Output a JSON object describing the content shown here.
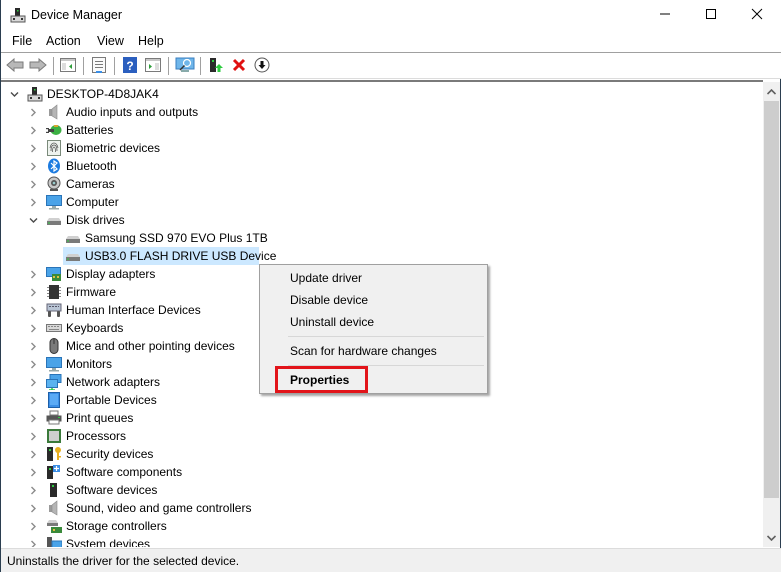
{
  "window": {
    "title": "Device Manager",
    "controls": {
      "minimize": "minimize",
      "maximize": "maximize",
      "close": "close"
    }
  },
  "menubar": {
    "items": [
      {
        "label": "File"
      },
      {
        "label": "Action"
      },
      {
        "label": "View"
      },
      {
        "label": "Help"
      }
    ]
  },
  "toolbar": {
    "buttons": [
      {
        "name": "back",
        "icon": "arrow-left-icon"
      },
      {
        "name": "forward",
        "icon": "arrow-right-icon"
      },
      {
        "name": "show-hide-console-tree",
        "icon": "console-tree-icon"
      },
      {
        "name": "properties",
        "icon": "properties-icon"
      },
      {
        "name": "help",
        "icon": "help-icon"
      },
      {
        "name": "show-hide-action-pane",
        "icon": "action-pane-icon"
      },
      {
        "name": "scan-hardware",
        "icon": "scan-monitor-icon"
      },
      {
        "name": "update-driver",
        "icon": "update-driver-icon"
      },
      {
        "name": "uninstall-device",
        "icon": "red-x-icon"
      },
      {
        "name": "disable-device",
        "icon": "down-arrow-circle-icon"
      }
    ]
  },
  "tree": {
    "root": {
      "label": "DESKTOP-4D8JAK4",
      "expanded": true
    },
    "categories": [
      {
        "label": "Audio inputs and outputs",
        "icon": "speaker-icon",
        "expanded": false
      },
      {
        "label": "Batteries",
        "icon": "battery-icon",
        "expanded": false
      },
      {
        "label": "Biometric devices",
        "icon": "fingerprint-icon",
        "expanded": false
      },
      {
        "label": "Bluetooth",
        "icon": "bluetooth-icon",
        "expanded": false
      },
      {
        "label": "Cameras",
        "icon": "webcam-icon",
        "expanded": false
      },
      {
        "label": "Computer",
        "icon": "monitor-icon",
        "expanded": false
      },
      {
        "label": "Disk drives",
        "icon": "disk-drive-icon",
        "expanded": true,
        "children": [
          {
            "label": "Samsung SSD 970 EVO Plus 1TB",
            "icon": "disk-drive-icon",
            "selected": false
          },
          {
            "label": "USB3.0 FLASH DRIVE USB Device",
            "icon": "disk-drive-icon",
            "selected": true
          }
        ]
      },
      {
        "label": "Display adapters",
        "icon": "display-adapter-icon",
        "expanded": false
      },
      {
        "label": "Firmware",
        "icon": "chip-icon",
        "expanded": false
      },
      {
        "label": "Human Interface Devices",
        "icon": "hid-icon",
        "expanded": false
      },
      {
        "label": "Keyboards",
        "icon": "keyboard-icon",
        "expanded": false
      },
      {
        "label": "Mice and other pointing devices",
        "icon": "mouse-icon",
        "expanded": false
      },
      {
        "label": "Monitors",
        "icon": "monitor-icon",
        "expanded": false
      },
      {
        "label": "Network adapters",
        "icon": "network-icon",
        "expanded": false
      },
      {
        "label": "Portable Devices",
        "icon": "portable-device-icon",
        "expanded": false
      },
      {
        "label": "Print queues",
        "icon": "printer-icon",
        "expanded": false
      },
      {
        "label": "Processors",
        "icon": "processor-icon",
        "expanded": false
      },
      {
        "label": "Security devices",
        "icon": "security-key-icon",
        "expanded": false
      },
      {
        "label": "Software components",
        "icon": "software-component-icon",
        "expanded": false
      },
      {
        "label": "Software devices",
        "icon": "software-device-icon",
        "expanded": false
      },
      {
        "label": "Sound, video and game controllers",
        "icon": "speaker-icon",
        "expanded": false
      },
      {
        "label": "Storage controllers",
        "icon": "storage-controller-icon",
        "expanded": false
      },
      {
        "label": "System devices",
        "icon": "system-device-icon",
        "expanded": false
      }
    ]
  },
  "context_menu": {
    "items": [
      {
        "label": "Update driver"
      },
      {
        "label": "Disable device"
      },
      {
        "label": "Uninstall device"
      },
      {
        "label": "Scan for hardware changes"
      },
      {
        "label": "Properties",
        "bold": true,
        "highlighted": true
      }
    ]
  },
  "statusbar": {
    "text": "Uninstalls the driver for the selected device."
  },
  "colors": {
    "selection": "#cce8ff",
    "highlight_box": "#e2141a",
    "menu_bg": "#f0f0f0",
    "window_border": "#2b3e50"
  }
}
